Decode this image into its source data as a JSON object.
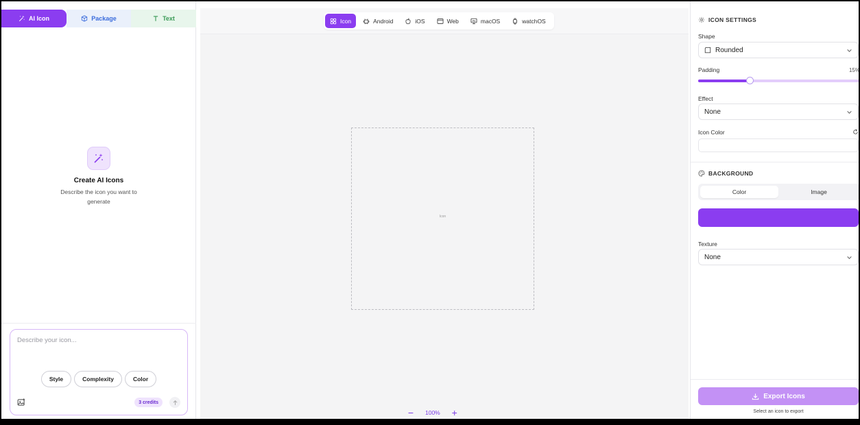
{
  "left": {
    "tabs": [
      {
        "label": "AI Icon",
        "icon": "magic-wand-icon"
      },
      {
        "label": "Package",
        "icon": "package-icon"
      },
      {
        "label": "Text",
        "icon": "text-icon"
      }
    ],
    "empty_state": {
      "icon": "magic-wand-icon",
      "title": "Create AI Icons",
      "description": "Describe the icon you want to generate"
    },
    "prompt": {
      "placeholder": "Describe your icon...",
      "value": "",
      "chips": [
        "Style",
        "Complexity",
        "Color"
      ],
      "credits": "3 credits"
    }
  },
  "center": {
    "platform_tabs": [
      {
        "label": "Icon",
        "icon": "grid-icon",
        "active": true
      },
      {
        "label": "Android",
        "icon": "android-icon",
        "active": false
      },
      {
        "label": "iOS",
        "icon": "apple-icon",
        "active": false
      },
      {
        "label": "Web",
        "icon": "browser-icon",
        "active": false
      },
      {
        "label": "macOS",
        "icon": "monitor-icon",
        "active": false
      },
      {
        "label": "watchOS",
        "icon": "watch-icon",
        "active": false
      }
    ],
    "canvas_label": "Icon",
    "zoom": {
      "minus": "−",
      "value": "100%",
      "plus": "+"
    }
  },
  "right": {
    "icon_settings": {
      "title": "ICON SETTINGS",
      "shape_label": "Shape",
      "shape_value": "Rounded",
      "padding_label": "Padding",
      "padding_value": "15%",
      "padding_fraction": 0.15,
      "effect_label": "Effect",
      "effect_value": "None",
      "icon_color_label": "Icon Color"
    },
    "background": {
      "title": "BACKGROUND",
      "tabs": [
        "Color",
        "Image"
      ],
      "active_tab": "Color",
      "color": "#8b3df0",
      "texture_label": "Texture",
      "texture_value": "None"
    },
    "export": {
      "button_label": "Export Icons",
      "hint": "Select an icon to export"
    }
  },
  "colors": {
    "accent": "#8b3df0",
    "accent_light": "#efe3fd"
  }
}
